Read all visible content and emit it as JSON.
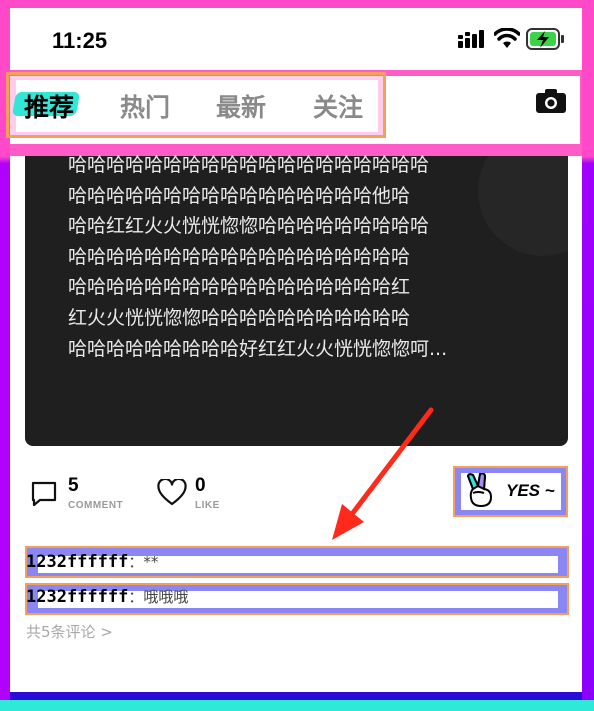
{
  "status_bar": {
    "time": "11:25"
  },
  "tabs": [
    {
      "label": "推荐",
      "active": true
    },
    {
      "label": "热门",
      "active": false
    },
    {
      "label": "最新",
      "active": false
    },
    {
      "label": "关注",
      "active": false
    }
  ],
  "header": {
    "camera_icon": "camera-icon"
  },
  "post": {
    "text": "哈哈哈哈哈哈哈哈哈哈哈哈哈哈哈哈哈哈哈\n哈哈哈哈哈哈哈哈哈哈哈哈哈哈哈哈他哈\n哈哈红红火火恍恍惚惚哈哈哈哈哈哈哈哈哈\n哈哈哈哈哈哈哈哈哈哈哈哈哈哈哈哈哈哈\n哈哈哈哈哈哈哈哈哈哈哈哈哈哈哈哈哈红\n红火火恍恍惚惚哈哈哈哈哈哈哈哈哈哈哈\n哈哈哈哈哈哈哈哈哈好红红火火恍恍惚惚呵..."
  },
  "stats": {
    "comment_count": "5",
    "comment_label": "COMMENT",
    "like_count": "0",
    "like_label": "LIKE"
  },
  "yes_button": {
    "label": "YES ~"
  },
  "comments": [
    {
      "user": "1232ffffff",
      "sep": "：",
      "text": "**"
    },
    {
      "user": "1232ffffff",
      "sep": "：",
      "text": "哦哦哦"
    }
  ],
  "more_comments": "共5条评论 >",
  "colors": {
    "accent": "#34e6d8",
    "annotation": "#ff2a1a",
    "overlay_pink": "#ff49c8",
    "overlay_purple": "#8a86f4"
  }
}
